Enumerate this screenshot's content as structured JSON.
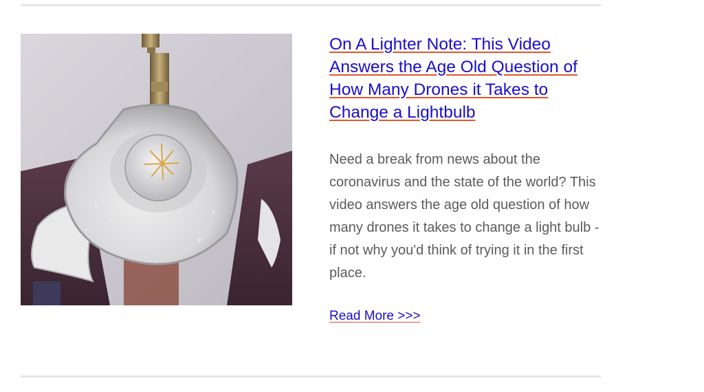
{
  "article": {
    "title": "On A Lighter Note:  This Video Answers the Age Old Question of How Many Drones it Takes to Change a Lightbulb",
    "summary": "Need a break from news about the coronavirus and the state of the world? This video answers the age old question of how many drones it takes to change a light bulb - if not why you'd think of trying it in the first place.",
    "read_more": "Read More >>>",
    "image_subject": "ceiling-light-fixture-photo"
  },
  "colors": {
    "link": "#1a0dcc",
    "underline_accent": "#e2552a",
    "body_text": "#5a5a5a",
    "divider": "#e6e6e6"
  }
}
